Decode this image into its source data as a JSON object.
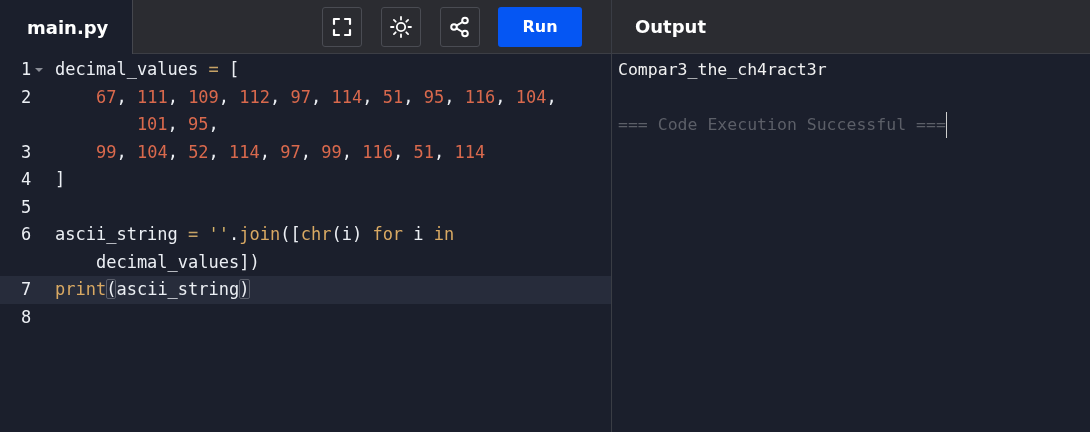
{
  "editor": {
    "tab": {
      "label": "main.py",
      "selected": true
    },
    "toolbar": [
      {
        "kind": "fullscreen"
      },
      {
        "kind": "theme"
      },
      {
        "kind": "share"
      }
    ],
    "run_button": {
      "label": "Run"
    },
    "lines": [
      {
        "number": "1",
        "foldable": true,
        "active": false,
        "tokens": [
          {
            "text": "decimal_values",
            "kind": "plain"
          },
          {
            "text": " = ",
            "kind": "operator"
          },
          {
            "text": "[",
            "kind": "plain"
          }
        ]
      },
      {
        "number": "2",
        "foldable": false,
        "active": false,
        "tokens": [
          {
            "text": "    67",
            "kind": "number"
          },
          {
            "text": ", ",
            "kind": "plain"
          },
          {
            "text": "111",
            "kind": "number"
          },
          {
            "text": ", ",
            "kind": "plain"
          },
          {
            "text": "109",
            "kind": "number"
          },
          {
            "text": ", ",
            "kind": "plain"
          },
          {
            "text": "112",
            "kind": "number"
          },
          {
            "text": ", ",
            "kind": "plain"
          },
          {
            "text": "97",
            "kind": "number"
          },
          {
            "text": ", ",
            "kind": "plain"
          },
          {
            "text": "114",
            "kind": "number"
          },
          {
            "text": ", ",
            "kind": "plain"
          },
          {
            "text": "51",
            "kind": "number"
          },
          {
            "text": ", ",
            "kind": "plain"
          },
          {
            "text": "95",
            "kind": "number"
          },
          {
            "text": ", ",
            "kind": "plain"
          },
          {
            "text": "116",
            "kind": "number"
          },
          {
            "text": ", ",
            "kind": "plain"
          },
          {
            "text": "104",
            "kind": "number"
          },
          {
            "text": ", ",
            "kind": "plain"
          },
          {
            "text": "101",
            "kind": "number"
          },
          {
            "text": ", ",
            "kind": "plain"
          },
          {
            "text": "95",
            "kind": "number"
          },
          {
            "text": ",",
            "kind": "plain"
          }
        ]
      },
      {
        "number": "3",
        "foldable": false,
        "active": false,
        "tokens": [
          {
            "text": "    99",
            "kind": "number"
          },
          {
            "text": ", ",
            "kind": "plain"
          },
          {
            "text": "104",
            "kind": "number"
          },
          {
            "text": ", ",
            "kind": "plain"
          },
          {
            "text": "52",
            "kind": "number"
          },
          {
            "text": ", ",
            "kind": "plain"
          },
          {
            "text": "114",
            "kind": "number"
          },
          {
            "text": ", ",
            "kind": "plain"
          },
          {
            "text": "97",
            "kind": "number"
          },
          {
            "text": ", ",
            "kind": "plain"
          },
          {
            "text": "99",
            "kind": "number"
          },
          {
            "text": ", ",
            "kind": "plain"
          },
          {
            "text": "116",
            "kind": "number"
          },
          {
            "text": ", ",
            "kind": "plain"
          },
          {
            "text": "51",
            "kind": "number"
          },
          {
            "text": ", ",
            "kind": "plain"
          },
          {
            "text": "114",
            "kind": "number"
          }
        ]
      },
      {
        "number": "4",
        "foldable": false,
        "active": false,
        "tokens": [
          {
            "text": "]",
            "kind": "plain"
          }
        ]
      },
      {
        "number": "5",
        "foldable": false,
        "active": false
      },
      {
        "number": "6",
        "foldable": false,
        "active": false,
        "tokens": [
          {
            "text": "ascii_string",
            "kind": "plain"
          },
          {
            "text": " = ",
            "kind": "operator"
          },
          {
            "text": "''",
            "kind": "string"
          },
          {
            "text": ".",
            "kind": "plain"
          },
          {
            "text": "join",
            "kind": "builtin"
          },
          {
            "text": "([",
            "kind": "plain"
          },
          {
            "text": "chr",
            "kind": "builtin"
          },
          {
            "text": "(i) ",
            "kind": "plain"
          },
          {
            "text": "for",
            "kind": "keyword"
          },
          {
            "text": " i ",
            "kind": "plain"
          },
          {
            "text": "in",
            "kind": "keyword"
          },
          {
            "text": " decimal_values])",
            "kind": "plain"
          }
        ]
      },
      {
        "number": "7",
        "foldable": false,
        "active": true,
        "tokens": [
          {
            "text": "print",
            "kind": "builtin"
          },
          {
            "text": "(",
            "kind": "plain",
            "matched": true
          },
          {
            "text": "ascii_string",
            "kind": "plain"
          },
          {
            "text": ")",
            "kind": "plain",
            "matched": true
          }
        ]
      },
      {
        "number": "8",
        "foldable": false,
        "active": false
      }
    ]
  },
  "output": {
    "title": "Output",
    "lines": [
      {
        "text": "Compar3_the_ch4ract3r",
        "kind": "stdout"
      },
      {
        "kind": "blank"
      },
      {
        "text": "=== Code Execution Successful ===",
        "kind": "status"
      }
    ]
  }
}
